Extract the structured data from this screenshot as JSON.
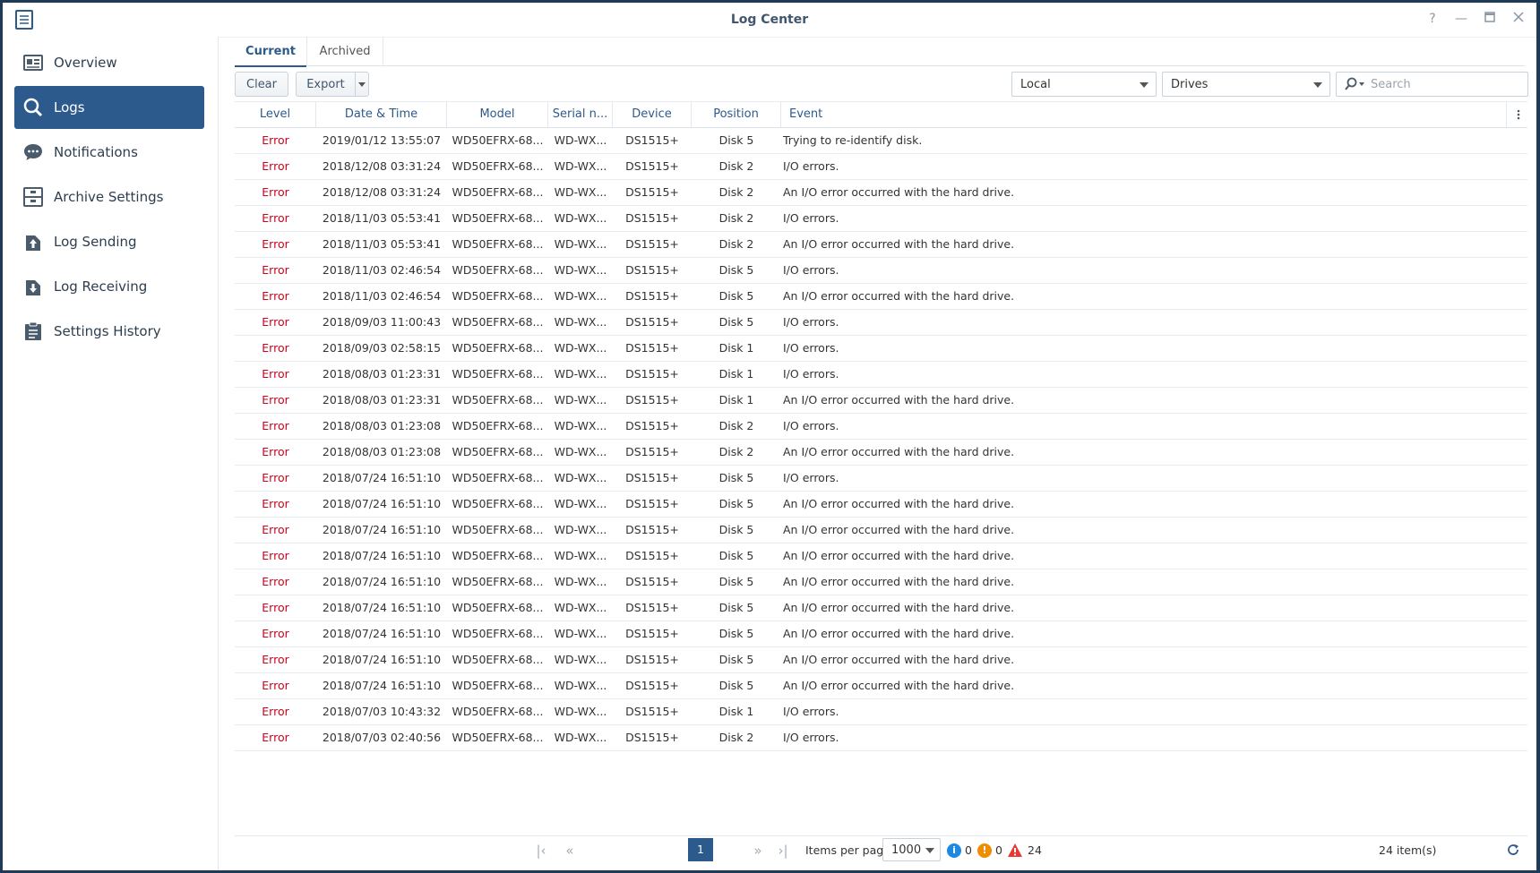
{
  "window": {
    "title": "Log Center"
  },
  "sidebar": {
    "items": [
      {
        "label": "Overview",
        "icon": "overview-icon"
      },
      {
        "label": "Logs",
        "icon": "search-icon"
      },
      {
        "label": "Notifications",
        "icon": "speech-bubble-icon"
      },
      {
        "label": "Archive Settings",
        "icon": "archive-icon"
      },
      {
        "label": "Log Sending",
        "icon": "upload-icon"
      },
      {
        "label": "Log Receiving",
        "icon": "download-icon"
      },
      {
        "label": "Settings History",
        "icon": "clipboard-icon"
      }
    ],
    "active": "Logs"
  },
  "tabs": [
    {
      "label": "Current"
    },
    {
      "label": "Archived"
    }
  ],
  "toolbar": {
    "clear_label": "Clear",
    "export_label": "Export",
    "source_select": "Local",
    "type_select": "Drives",
    "search_placeholder": "Search"
  },
  "columns": [
    "Level",
    "Date & Time",
    "Model",
    "Serial n...",
    "Device",
    "Position",
    "Event"
  ],
  "rows": [
    [
      "Error",
      "2019/01/12 13:55:07",
      "WD50EFRX-68...",
      "WD-WX...",
      "DS1515+",
      "Disk 5",
      "Trying to re-identify disk."
    ],
    [
      "Error",
      "2018/12/08 03:31:24",
      "WD50EFRX-68...",
      "WD-WX...",
      "DS1515+",
      "Disk 2",
      "I/O errors."
    ],
    [
      "Error",
      "2018/12/08 03:31:24",
      "WD50EFRX-68...",
      "WD-WX...",
      "DS1515+",
      "Disk 2",
      "An I/O error occurred with the hard drive."
    ],
    [
      "Error",
      "2018/11/03 05:53:41",
      "WD50EFRX-68...",
      "WD-WX...",
      "DS1515+",
      "Disk 2",
      "I/O errors."
    ],
    [
      "Error",
      "2018/11/03 05:53:41",
      "WD50EFRX-68...",
      "WD-WX...",
      "DS1515+",
      "Disk 2",
      "An I/O error occurred with the hard drive."
    ],
    [
      "Error",
      "2018/11/03 02:46:54",
      "WD50EFRX-68...",
      "WD-WX...",
      "DS1515+",
      "Disk 5",
      "I/O errors."
    ],
    [
      "Error",
      "2018/11/03 02:46:54",
      "WD50EFRX-68...",
      "WD-WX...",
      "DS1515+",
      "Disk 5",
      "An I/O error occurred with the hard drive."
    ],
    [
      "Error",
      "2018/09/03 11:00:43",
      "WD50EFRX-68...",
      "WD-WX...",
      "DS1515+",
      "Disk 5",
      "I/O errors."
    ],
    [
      "Error",
      "2018/09/03 02:58:15",
      "WD50EFRX-68...",
      "WD-WX...",
      "DS1515+",
      "Disk 1",
      "I/O errors."
    ],
    [
      "Error",
      "2018/08/03 01:23:31",
      "WD50EFRX-68...",
      "WD-WX...",
      "DS1515+",
      "Disk 1",
      "I/O errors."
    ],
    [
      "Error",
      "2018/08/03 01:23:31",
      "WD50EFRX-68...",
      "WD-WX...",
      "DS1515+",
      "Disk 1",
      "An I/O error occurred with the hard drive."
    ],
    [
      "Error",
      "2018/08/03 01:23:08",
      "WD50EFRX-68...",
      "WD-WX...",
      "DS1515+",
      "Disk 2",
      "I/O errors."
    ],
    [
      "Error",
      "2018/08/03 01:23:08",
      "WD50EFRX-68...",
      "WD-WX...",
      "DS1515+",
      "Disk 2",
      "An I/O error occurred with the hard drive."
    ],
    [
      "Error",
      "2018/07/24 16:51:10",
      "WD50EFRX-68...",
      "WD-WX...",
      "DS1515+",
      "Disk 5",
      "I/O errors."
    ],
    [
      "Error",
      "2018/07/24 16:51:10",
      "WD50EFRX-68...",
      "WD-WX...",
      "DS1515+",
      "Disk 5",
      "An I/O error occurred with the hard drive."
    ],
    [
      "Error",
      "2018/07/24 16:51:10",
      "WD50EFRX-68...",
      "WD-WX...",
      "DS1515+",
      "Disk 5",
      "An I/O error occurred with the hard drive."
    ],
    [
      "Error",
      "2018/07/24 16:51:10",
      "WD50EFRX-68...",
      "WD-WX...",
      "DS1515+",
      "Disk 5",
      "An I/O error occurred with the hard drive."
    ],
    [
      "Error",
      "2018/07/24 16:51:10",
      "WD50EFRX-68...",
      "WD-WX...",
      "DS1515+",
      "Disk 5",
      "An I/O error occurred with the hard drive."
    ],
    [
      "Error",
      "2018/07/24 16:51:10",
      "WD50EFRX-68...",
      "WD-WX...",
      "DS1515+",
      "Disk 5",
      "An I/O error occurred with the hard drive."
    ],
    [
      "Error",
      "2018/07/24 16:51:10",
      "WD50EFRX-68...",
      "WD-WX...",
      "DS1515+",
      "Disk 5",
      "An I/O error occurred with the hard drive."
    ],
    [
      "Error",
      "2018/07/24 16:51:10",
      "WD50EFRX-68...",
      "WD-WX...",
      "DS1515+",
      "Disk 5",
      "An I/O error occurred with the hard drive."
    ],
    [
      "Error",
      "2018/07/24 16:51:10",
      "WD50EFRX-68...",
      "WD-WX...",
      "DS1515+",
      "Disk 5",
      "An I/O error occurred with the hard drive."
    ],
    [
      "Error",
      "2018/07/03 10:43:32",
      "WD50EFRX-68...",
      "WD-WX...",
      "DS1515+",
      "Disk 1",
      "I/O errors."
    ],
    [
      "Error",
      "2018/07/03 02:40:56",
      "WD50EFRX-68...",
      "WD-WX...",
      "DS1515+",
      "Disk 2",
      "I/O errors."
    ]
  ],
  "footer": {
    "current_page": "1",
    "items_per_page_label": "Items per page",
    "items_per_page": "1000",
    "info_count": "0",
    "warning_count": "0",
    "error_count": "24",
    "total_items": "24 item(s)"
  },
  "colors": {
    "accent": "#2d5a8c",
    "error": "#d0021b",
    "info": "#1e88e5",
    "warning": "#f08c00",
    "danger": "#e53935"
  }
}
